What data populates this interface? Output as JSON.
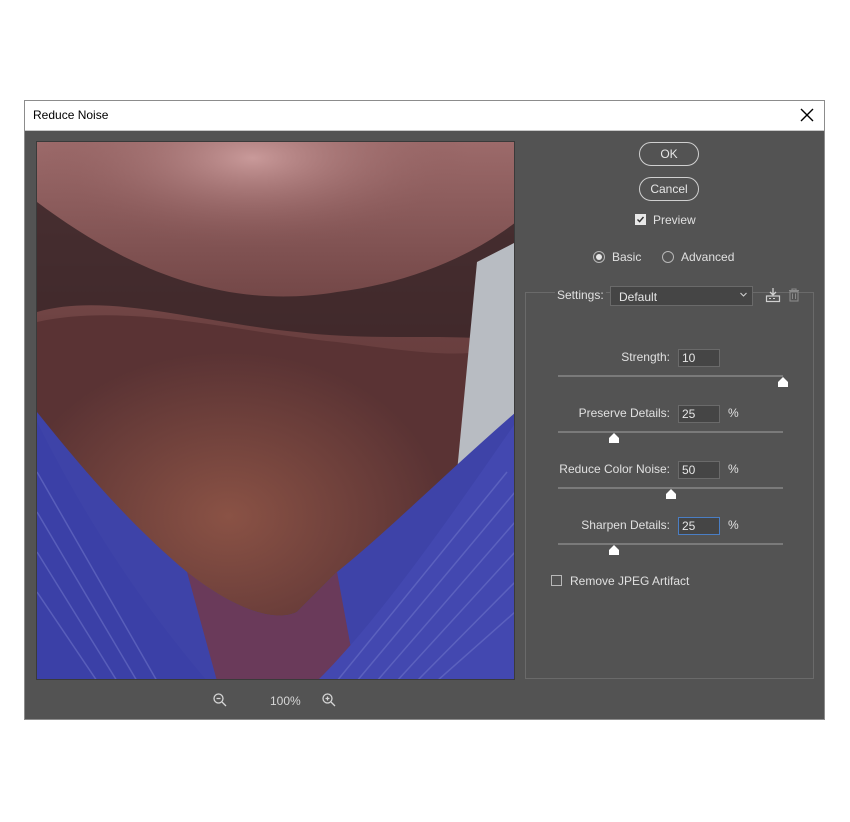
{
  "dialog": {
    "title": "Reduce Noise"
  },
  "preview": {
    "zoom": "100%"
  },
  "buttons": {
    "ok": "OK",
    "cancel": "Cancel"
  },
  "preview_toggle": {
    "label": "Preview",
    "checked": true
  },
  "mode": {
    "basic": "Basic",
    "advanced": "Advanced",
    "selected": "Basic"
  },
  "settings": {
    "label": "Settings:",
    "value": "Default"
  },
  "sliders": [
    {
      "label": "Strength:",
      "value": "10",
      "unit": "",
      "fraction": 1.0
    },
    {
      "label": "Preserve Details:",
      "value": "25",
      "unit": "%",
      "fraction": 0.25
    },
    {
      "label": "Reduce Color Noise:",
      "value": "50",
      "unit": "%",
      "fraction": 0.5
    },
    {
      "label": "Sharpen Details:",
      "value": "25",
      "unit": "%",
      "fraction": 0.25
    }
  ],
  "jpeg": {
    "label": "Remove JPEG Artifact",
    "checked": false
  },
  "colors": {
    "dialog_bg": "#535353",
    "focus": "#4a7ec4"
  }
}
